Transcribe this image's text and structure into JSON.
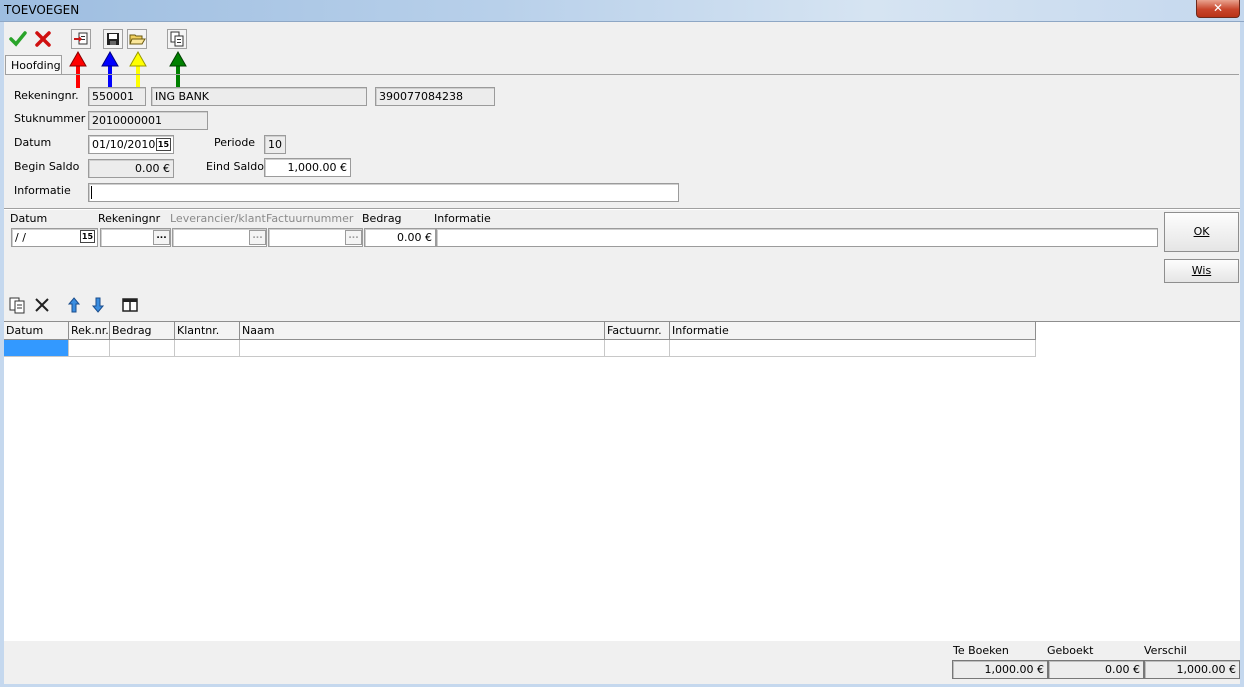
{
  "window": {
    "title": "TOEVOEGEN",
    "close_label": "✕"
  },
  "toolbar": {
    "icons": [
      "check-icon",
      "cancel-icon",
      "new-document-icon",
      "save-icon",
      "open-folder-icon",
      "copy-icon"
    ]
  },
  "annotations": {
    "colors": [
      "#ff0000",
      "#0000ff",
      "#ffff00",
      "#008000"
    ]
  },
  "tabs": [
    {
      "label": "Hoofding"
    }
  ],
  "header": {
    "rekeningnr_label": "Rekeningnr.",
    "rekeningnr_value": "550001",
    "bank_name": "ING BANK",
    "bank_account": "390077084238",
    "stuknummer_label": "Stuknummer",
    "stuknummer_value": "2010000001",
    "datum_label": "Datum",
    "datum_value": "01/10/2010",
    "periode_label": "Periode",
    "periode_value": "10",
    "begin_saldo_label": "Begin Saldo",
    "begin_saldo_value": "0.00 €",
    "eind_saldo_label": "Eind Saldo",
    "eind_saldo_value": "1,000.00 €",
    "informatie_label": "Informatie",
    "informatie_value": ""
  },
  "entry": {
    "datum_label": "Datum",
    "rekeningnr_label": "Rekeningnr",
    "leverancier_label": "Leverancier/klant",
    "factuurnummer_label": "Factuurnummer",
    "bedrag_label": "Bedrag",
    "informatie_label": "Informatie",
    "datum_value": " / /",
    "bedrag_value": "0.00 €",
    "dots": "...",
    "calendar": "15",
    "ok_label": "OK",
    "wis_label": "Wis"
  },
  "grid": {
    "columns": [
      "Datum",
      "Rek.nr.",
      "Bedrag",
      "Klantnr.",
      "Naam",
      "Factuurnr.",
      "Informatie"
    ]
  },
  "totals": {
    "te_boeken_label": "Te Boeken",
    "te_boeken_value": "1,000.00 €",
    "geboekt_label": "Geboekt",
    "geboekt_value": "0.00 €",
    "verschil_label": "Verschil",
    "verschil_value": "1,000.00 €"
  }
}
